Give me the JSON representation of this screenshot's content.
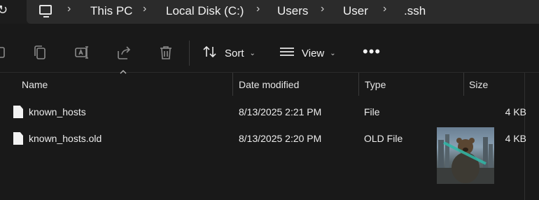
{
  "breadcrumb": {
    "items": [
      "This PC",
      "Local Disk (C:)",
      "Users",
      "User",
      ".ssh"
    ],
    "pc_icon": "computer-icon",
    "separator_icon": "chevron-right-icon"
  },
  "toolbar": {
    "icons": [
      "copy-icon",
      "rename-icon",
      "share-icon",
      "delete-icon"
    ],
    "sort_label": "Sort",
    "view_label": "View",
    "more_icon": "more-horizontal-icon"
  },
  "columns": {
    "name": "Name",
    "date_modified": "Date modified",
    "type": "Type",
    "size": "Size"
  },
  "files": [
    {
      "name": "known_hosts",
      "date": "8/13/2025 2:21 PM",
      "type": "File",
      "size": "4 KB"
    },
    {
      "name": "known_hosts.old",
      "date": "8/13/2025 2:20 PM",
      "type": "OLD File",
      "size": "4 KB"
    }
  ],
  "thumbnail": {
    "icon": "bear-image-thumbnail"
  }
}
